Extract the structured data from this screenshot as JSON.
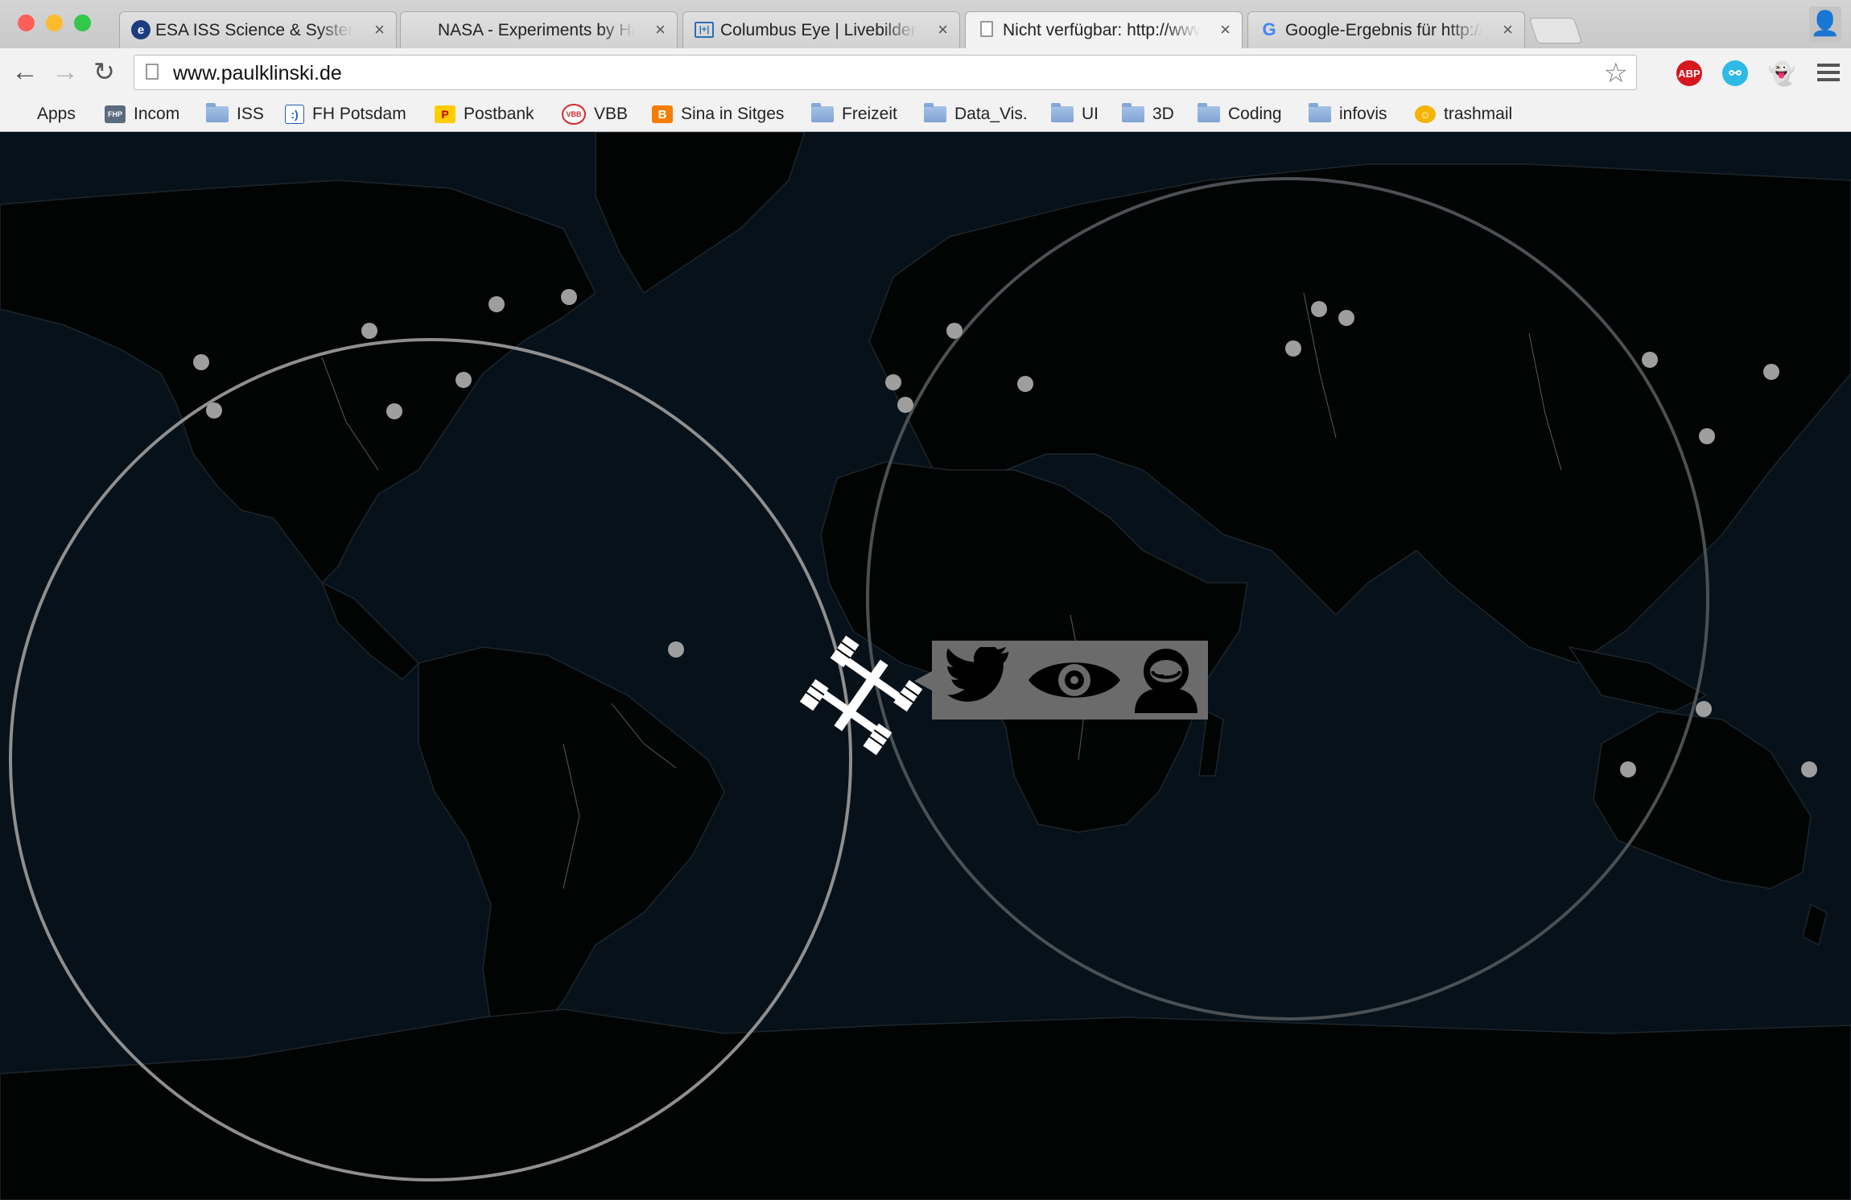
{
  "window": {
    "traffic_lights": [
      "#fc5f57",
      "#fdbc2e",
      "#34c84a"
    ]
  },
  "tabs": [
    {
      "title": "ESA ISS Science & System",
      "favicon": "esa-icon",
      "active": false
    },
    {
      "title": "NASA - Experiments by Ha",
      "favicon": "none",
      "active": false
    },
    {
      "title": "Columbus Eye | Livebilder v",
      "favicon": "columbus-eye-icon",
      "active": false
    },
    {
      "title": "Nicht verfügbar: http://www",
      "favicon": "page-icon",
      "active": true
    },
    {
      "title": "Google-Ergebnis für http://",
      "favicon": "google-icon",
      "active": false
    }
  ],
  "toolbar": {
    "url": "www.paulklinski.de",
    "extensions": [
      {
        "name": "adblock-plus-icon",
        "label": "ABP",
        "color": "#d6171e"
      },
      {
        "name": "share-extension-icon",
        "label": "",
        "color": "#2fb9e6"
      },
      {
        "name": "ghostery-icon",
        "label": "",
        "color": "#666666"
      }
    ]
  },
  "bookmarks": [
    {
      "label": "Apps",
      "icon": "apps-grid-icon"
    },
    {
      "label": "Incom",
      "icon": "fhp-icon"
    },
    {
      "label": "ISS",
      "icon": "folder-icon"
    },
    {
      "label": "FH Potsdam",
      "icon": "fh-potsdam-icon"
    },
    {
      "label": "Postbank",
      "icon": "postbank-icon"
    },
    {
      "label": "VBB",
      "icon": "vbb-icon"
    },
    {
      "label": "Sina in Sitges",
      "icon": "blogger-icon"
    },
    {
      "label": "Freizeit",
      "icon": "folder-icon"
    },
    {
      "label": "Data_Vis.",
      "icon": "folder-icon"
    },
    {
      "label": "UI",
      "icon": "folder-icon"
    },
    {
      "label": "3D",
      "icon": "folder-icon"
    },
    {
      "label": "Coding",
      "icon": "folder-icon"
    },
    {
      "label": "infovis",
      "icon": "folder-icon"
    },
    {
      "label": "trashmail",
      "icon": "trashmail-icon"
    }
  ],
  "map": {
    "background": "#06111a",
    "land_color": "#020303",
    "action_bar": {
      "buttons": [
        "twitter-icon",
        "eye-icon",
        "astronaut-icon"
      ]
    }
  }
}
